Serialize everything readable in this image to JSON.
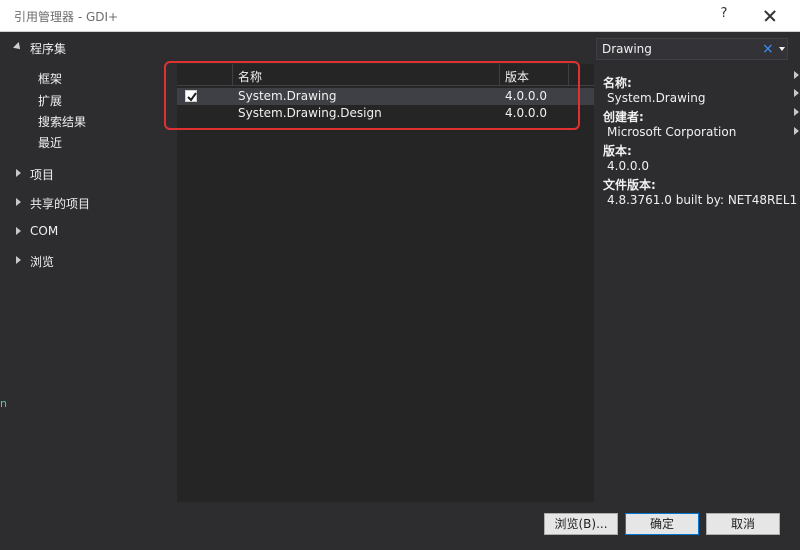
{
  "window": {
    "title": "引用管理器 - GDI+",
    "help_label": "?"
  },
  "sidebar": {
    "assemblies_label": "程序集",
    "assemblies_children": [
      {
        "label": "框架"
      },
      {
        "label": "扩展"
      },
      {
        "label": "搜索结果"
      },
      {
        "label": "最近"
      }
    ],
    "groups": [
      {
        "label": "项目"
      },
      {
        "label": "共享的项目"
      },
      {
        "label": "COM"
      },
      {
        "label": "浏览"
      }
    ]
  },
  "list": {
    "headers": {
      "name": "名称",
      "version": "版本"
    },
    "rows": [
      {
        "name": "System.Drawing",
        "version": "4.0.0.0",
        "checked": true,
        "selected": true
      },
      {
        "name": "System.Drawing.Design",
        "version": "4.0.0.0",
        "checked": false,
        "selected": false
      }
    ]
  },
  "search": {
    "value": "Drawing",
    "clear_label": "×"
  },
  "details": {
    "name_label": "名称:",
    "name_value": "System.Drawing",
    "creator_label": "创建者:",
    "creator_value": "Microsoft Corporation",
    "version_label": "版本:",
    "version_value": "4.0.0.0",
    "file_version_label": "文件版本:",
    "file_version_value": "4.8.3761.0 built by: NET48REL1"
  },
  "buttons": {
    "browse": "浏览(B)...",
    "ok": "确定",
    "cancel": "取消"
  },
  "edge_text": "n",
  "colors": {
    "background": "#2d2d30",
    "list_background": "#252526",
    "selected_row": "#3f3f46",
    "highlight_box": "#e03131",
    "accent": "#3794ff"
  }
}
